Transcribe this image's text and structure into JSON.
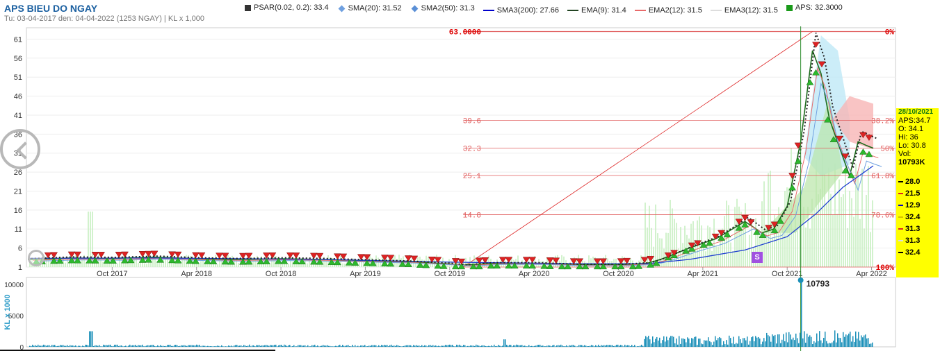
{
  "title": "APS BIEU DO NGAY",
  "subtitle": "Tu: 03-04-2017 den: 04-04-2022 (1253 NGAY) | KL x 1,000",
  "legend": [
    {
      "label": "PSAR(0.02, 0.2): 33.4",
      "color": "#333333",
      "shape": "square"
    },
    {
      "label": "SMA(20): 31.52",
      "color": "#6fa0e0",
      "shape": "diamond"
    },
    {
      "label": "SMA2(50): 31.3",
      "color": "#5a8fd6",
      "shape": "diamond"
    },
    {
      "label": "SMA3(200): 27.66",
      "color": "#0000cc",
      "shape": "line"
    },
    {
      "label": "EMA(9): 31.4",
      "color": "#224422",
      "shape": "line"
    },
    {
      "label": "EMA2(12): 31.5",
      "color": "#e86a6a",
      "shape": "line"
    },
    {
      "label": "EMA3(12): 31.5",
      "color": "#dddddd",
      "shape": "line"
    },
    {
      "label": "APS: 32.3000",
      "color": "#1a9a1a",
      "shape": "square"
    }
  ],
  "colors": {
    "fib": "#e05a5a",
    "fib_top": "#dd0000",
    "up": "#2db82d",
    "down": "#dd2222",
    "volume": "#1a8fb8",
    "sma200": "#1f3fd0",
    "cursor": "#2a8a2a"
  },
  "infobox": {
    "date": "28/10/2021",
    "lines": [
      "APS:34.7",
      "O: 34.1",
      "Hi: 36",
      "Lo: 30.8",
      "Vol:",
      "10793K"
    ],
    "values": [
      {
        "text": "28.0",
        "color": "#000000"
      },
      {
        "text": "21.5",
        "color": "#dd2222"
      },
      {
        "text": "12.9",
        "color": "#0000cc"
      },
      {
        "text": "32.4",
        "color": "#d4c000"
      },
      {
        "text": "31.3",
        "color": "#dd2222"
      },
      {
        "text": "31.3",
        "color": "#dddddd"
      },
      {
        "text": "32.4",
        "color": "#000000"
      }
    ]
  },
  "cursor_volume_label": "10793",
  "signal_badge": "S",
  "chart_data": {
    "type": "candlestick",
    "x_ticks": [
      "Oct 2017",
      "Apr 2018",
      "Oct 2018",
      "Apr 2019",
      "Oct 2019",
      "Apr 2020",
      "Oct 2020",
      "Apr 2021",
      "Oct 2021",
      "Apr 2022"
    ],
    "y_ticks": [
      1,
      6,
      11,
      16,
      21,
      26,
      31,
      36,
      41,
      46,
      51,
      56,
      61
    ],
    "ylim": [
      1,
      64
    ],
    "volume_ticks": [
      "0",
      "5000",
      "10000"
    ],
    "volume_ylabel": "KL x 1000",
    "volume_ylim": [
      0,
      10000
    ],
    "fibonacci": [
      {
        "price_label": "63.0000",
        "pct_label": "0%",
        "value": 63.0
      },
      {
        "price_label": "39.6",
        "pct_label": "38.2%",
        "value": 39.6
      },
      {
        "price_label": "32.3",
        "pct_label": "50%",
        "value": 32.3
      },
      {
        "price_label": "25.1",
        "pct_label": "61.8%",
        "value": 25.1
      },
      {
        "price_label": "14.8",
        "pct_label": "78.6%",
        "value": 14.8
      },
      {
        "price_label": "",
        "pct_label": "100%",
        "value": 1.0
      }
    ],
    "price_series": [
      [
        2017.25,
        3.0
      ],
      [
        2017.5,
        3.4
      ],
      [
        2017.75,
        3.3
      ],
      [
        2018.0,
        3.6
      ],
      [
        2018.25,
        3.2
      ],
      [
        2018.5,
        3.0
      ],
      [
        2018.75,
        3.2
      ],
      [
        2019.0,
        3.0
      ],
      [
        2019.25,
        2.7
      ],
      [
        2019.5,
        2.4
      ],
      [
        2019.75,
        1.8
      ],
      [
        2019.83,
        1.5
      ],
      [
        2020.0,
        2.0
      ],
      [
        2020.25,
        2.0
      ],
      [
        2020.5,
        1.6
      ],
      [
        2020.75,
        1.6
      ],
      [
        2020.92,
        2.0
      ],
      [
        2021.0,
        3.0
      ],
      [
        2021.17,
        6.0
      ],
      [
        2021.33,
        8.5
      ],
      [
        2021.5,
        13.0
      ],
      [
        2021.6,
        10.0
      ],
      [
        2021.67,
        11.0
      ],
      [
        2021.75,
        17.0
      ],
      [
        2021.83,
        34.0
      ],
      [
        2021.9,
        58.0
      ],
      [
        2021.95,
        52.0
      ],
      [
        2022.0,
        40.0
      ],
      [
        2022.08,
        30.0
      ],
      [
        2022.12,
        25.0
      ],
      [
        2022.17,
        34.0
      ],
      [
        2022.22,
        33.0
      ],
      [
        2022.26,
        32.3
      ]
    ],
    "sma200_series": [
      [
        2017.25,
        3.3
      ],
      [
        2018.0,
        3.4
      ],
      [
        2019.0,
        3.0
      ],
      [
        2019.75,
        2.3
      ],
      [
        2020.5,
        1.9
      ],
      [
        2020.92,
        1.9
      ],
      [
        2021.17,
        3.0
      ],
      [
        2021.5,
        5.5
      ],
      [
        2021.75,
        9.0
      ],
      [
        2021.92,
        15.0
      ],
      [
        2022.08,
        22.0
      ],
      [
        2022.26,
        27.66
      ]
    ],
    "cursor_date": "2021-10-28",
    "cursor_x": 2021.83,
    "fib_trend_start": [
      2019.83,
      1.0
    ],
    "fib_trend_end": [
      2021.9,
      63.0
    ],
    "volume_spike": [
      2021.83,
      10793
    ]
  }
}
